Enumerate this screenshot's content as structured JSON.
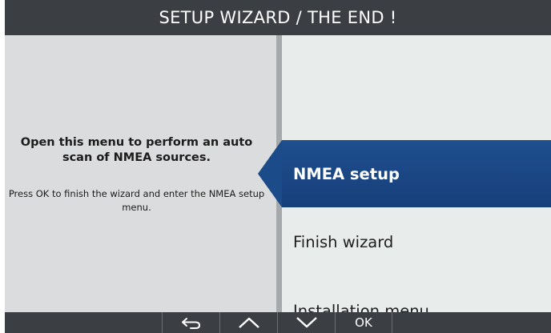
{
  "title": "SETUP WIZARD / THE END !",
  "help": {
    "headline": "Open this menu to perform an auto scan of NMEA sources.",
    "detail": "Press OK to finish the wizard and enter the NMEA setup menu."
  },
  "menu": {
    "items": [
      {
        "label": "NMEA setup",
        "selected": true
      },
      {
        "label": "Finish wizard",
        "selected": false
      },
      {
        "label": "Installation menu",
        "selected": false
      }
    ]
  },
  "softkeys": {
    "back_icon": "back-arrow-icon",
    "up_icon": "chevron-up-icon",
    "down_icon": "chevron-down-icon",
    "ok_label": "OK"
  },
  "colors": {
    "titlebar": "#3b3e43",
    "selected": "#1c4b89",
    "panel": "#dbdcdd",
    "menu_bg": "#e8ecea"
  }
}
